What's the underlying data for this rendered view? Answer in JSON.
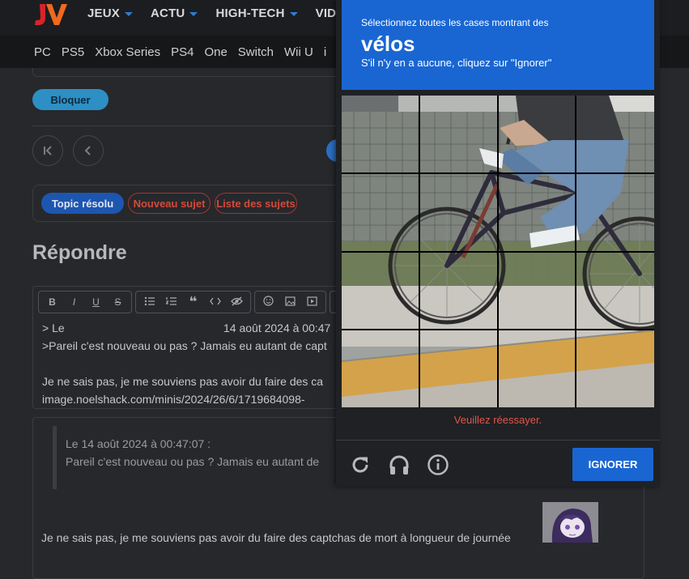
{
  "header": {
    "logo_text": "JV",
    "nav": [
      {
        "label": "JEUX",
        "has_caret": true
      },
      {
        "label": "ACTU",
        "has_caret": true
      },
      {
        "label": "HIGH-TECH",
        "has_caret": true
      },
      {
        "label": "VIDE",
        "has_caret": false
      }
    ],
    "platforms": [
      "PC",
      "PS5",
      "Xbox Series",
      "PS4",
      "One",
      "Switch",
      "Wii U",
      "i"
    ]
  },
  "forum": {
    "block_button": "Bloquer",
    "topic_actions": {
      "resolved": "Topic résolu",
      "new_topic": "Nouveau sujet",
      "topic_list": "Liste des sujets"
    },
    "reply_title": "Répondre",
    "editor": {
      "toolbar": [
        "B",
        "I",
        "U",
        "S"
      ],
      "line1_prefix": "> Le",
      "line1_date": "14 août 2024 à 00:47",
      "line2": ">Pareil c'est nouveau ou pas ? Jamais eu autant de capt",
      "line3": "Je ne sais pas, je me souviens pas avoir du faire des ca",
      "line4": "image.noelshack.com/minis/2024/26/6/1719684098-"
    },
    "preview": {
      "quote_header": "Le 14 août 2024 à 00:47:07 :",
      "quote_body": "Pareil c'est nouveau ou pas ? Jamais eu autant de",
      "reply_text": "Je ne sais pas, je me souviens pas avoir du faire des captchas de mort à longueur de journée"
    }
  },
  "captcha": {
    "instruction": "Sélectionnez toutes les cases montrant des",
    "target": "vélos",
    "subtext": "S'il n'y en a aucune, cliquez sur \"Ignorer\"",
    "error": "Veuillez réessayer.",
    "icons": [
      "reload-icon",
      "headphones-icon",
      "info-icon"
    ],
    "skip_button": "IGNORER",
    "colors": {
      "header": "#1966d2",
      "error": "#e0564a"
    }
  }
}
